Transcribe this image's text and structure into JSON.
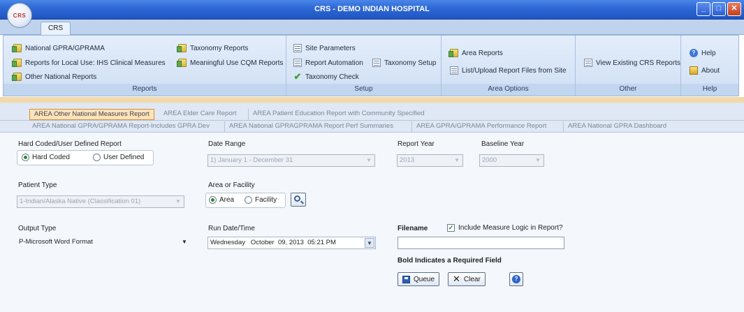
{
  "window": {
    "title": "CRS - DEMO INDIAN HOSPITAL",
    "orb_text": "CRS"
  },
  "ribbon": {
    "tab": "CRS",
    "groups": {
      "reports": {
        "label": "Reports",
        "items": [
          "National GPRA/GPRAMA",
          "Reports for Local Use: IHS Clinical Measures",
          "Other National Reports",
          "Taxonomy Reports",
          "Meaningful Use CQM Reports"
        ]
      },
      "setup": {
        "label": "Setup",
        "items": [
          "Site Parameters",
          "Report Automation",
          "Taxonomy Check",
          "Taxonomy Setup"
        ]
      },
      "area_options": {
        "label": "Area Options",
        "items": [
          "Area Reports",
          "List/Upload Report Files from Site"
        ]
      },
      "other": {
        "label": "Other",
        "items": [
          "View Existing CRS Reports"
        ]
      },
      "help": {
        "label": "Help",
        "items": [
          "Help",
          "About"
        ]
      }
    }
  },
  "tabs": {
    "row1": [
      "AREA Other National Measures Report",
      "AREA Elder Care Report",
      "AREA Patient Education Report with Community Specified"
    ],
    "row2": [
      "AREA National GPRA/GPRAMA Report-Includes GPRA Dev",
      "AREA National GPRAGPRAMA Report Perf Summaries",
      "AREA GPRA/GPRAMA Performance Report",
      "AREA National GPRA Dashboard"
    ]
  },
  "form": {
    "report_type": {
      "label": "Hard Coded/User Defined Report",
      "options": [
        "Hard Coded",
        "User Defined"
      ],
      "selected": "Hard Coded"
    },
    "date_range": {
      "label": "Date Range",
      "value": "1) January 1 - December 31"
    },
    "report_year": {
      "label": "Report Year",
      "value": "2013"
    },
    "baseline_year": {
      "label": "Baseline Year",
      "value": "2000"
    },
    "patient_type": {
      "label": "Patient Type",
      "value": "1-Indian/Alaska Native (Classification 01)"
    },
    "area_facility": {
      "label": "Area or Facility",
      "options": [
        "Area",
        "Facility"
      ],
      "selected": "Area"
    },
    "output_type": {
      "label": "Output Type",
      "value": "P-Microsoft Word Format"
    },
    "run_datetime": {
      "label": "Run Date/Time",
      "value": "Wednesday   October  09, 2013  05:21 PM"
    },
    "filename": {
      "label": "Filename",
      "value": ""
    },
    "include_logic": {
      "label": "Include Measure Logic in Report?",
      "checked": true
    },
    "required_note": "Bold Indicates a Required Field",
    "buttons": {
      "queue": "Queue",
      "clear": "Clear"
    }
  }
}
